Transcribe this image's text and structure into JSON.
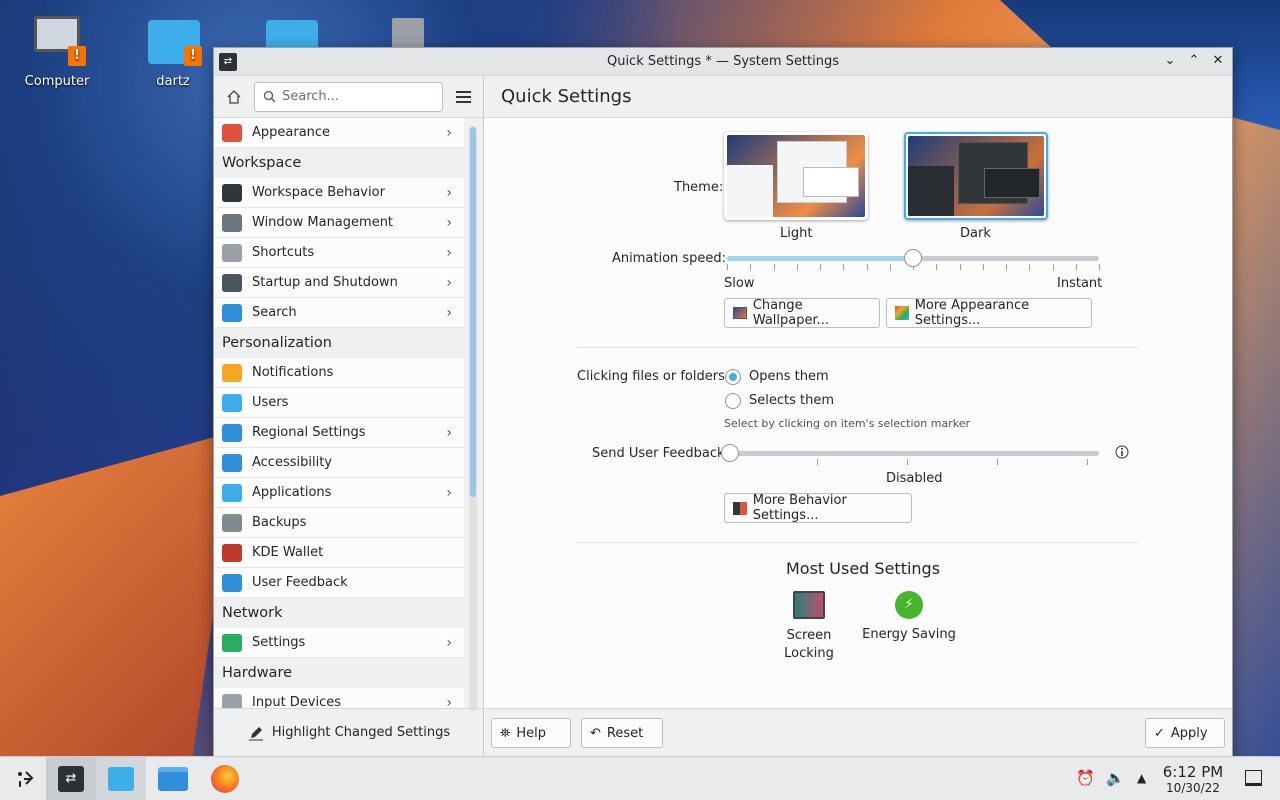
{
  "desktop": {
    "icons": [
      {
        "label": "Computer"
      },
      {
        "label": "dartz"
      }
    ]
  },
  "window": {
    "title": "Quick Settings * — System Settings",
    "controls": {
      "minimize": "⌄",
      "maximize": "⌃",
      "close": "✕"
    }
  },
  "sidebar": {
    "search_placeholder": "Search...",
    "items": [
      {
        "type": "item",
        "label": "Appearance",
        "chevron": true,
        "color": "#e0533a"
      },
      {
        "type": "category",
        "label": "Workspace"
      },
      {
        "type": "item",
        "label": "Workspace Behavior",
        "chevron": true,
        "color": "#31363b"
      },
      {
        "type": "item",
        "label": "Window Management",
        "chevron": true,
        "color": "#6c7680"
      },
      {
        "type": "item",
        "label": "Shortcuts",
        "chevron": true,
        "color": "#9aa0a6"
      },
      {
        "type": "item",
        "label": "Startup and Shutdown",
        "chevron": true,
        "color": "#4a5560"
      },
      {
        "type": "item",
        "label": "Search",
        "chevron": true,
        "color": "#2f8fd8"
      },
      {
        "type": "category",
        "label": "Personalization"
      },
      {
        "type": "item",
        "label": "Notifications",
        "chevron": false,
        "color": "#f5a623"
      },
      {
        "type": "item",
        "label": "Users",
        "chevron": false,
        "color": "#3daee9"
      },
      {
        "type": "item",
        "label": "Regional Settings",
        "chevron": true,
        "color": "#2f8fd8"
      },
      {
        "type": "item",
        "label": "Accessibility",
        "chevron": false,
        "color": "#2f8fd8"
      },
      {
        "type": "item",
        "label": "Applications",
        "chevron": true,
        "color": "#3daee9"
      },
      {
        "type": "item",
        "label": "Backups",
        "chevron": false,
        "color": "#7f8c8d"
      },
      {
        "type": "item",
        "label": "KDE Wallet",
        "chevron": false,
        "color": "#c0392b"
      },
      {
        "type": "item",
        "label": "User Feedback",
        "chevron": false,
        "color": "#2f8fd8"
      },
      {
        "type": "category",
        "label": "Network"
      },
      {
        "type": "item",
        "label": "Settings",
        "chevron": true,
        "color": "#27ae60"
      },
      {
        "type": "category",
        "label": "Hardware"
      },
      {
        "type": "item",
        "label": "Input Devices",
        "chevron": true,
        "color": "#9aa0a6"
      }
    ],
    "highlight_label": "Highlight Changed Settings"
  },
  "main": {
    "title": "Quick Settings",
    "theme_label": "Theme:",
    "theme_light": "Light",
    "theme_dark": "Dark",
    "animation_label": "Animation speed:",
    "animation_value": 0.5,
    "slow_label": "Slow",
    "instant_label": "Instant",
    "change_wallpaper": "Change Wallpaper...",
    "more_appearance": "More Appearance Settings...",
    "clicking_label": "Clicking files or folders:",
    "opens_them": "Opens them",
    "selects_them": "Selects them",
    "selects_hint": "Select by clicking on item's selection marker",
    "feedback_label": "Send User Feedback:",
    "feedback_value": "Disabled",
    "more_behavior": "More Behavior Settings...",
    "most_used_title": "Most Used Settings",
    "screen_locking": "Screen\nLocking",
    "energy_saving": "Energy Saving",
    "help": "Help",
    "reset": "Reset",
    "apply": "Apply"
  },
  "taskbar": {
    "time": "6:12 PM",
    "date": "10/30/22"
  },
  "colors": {
    "accent": "#3daee9"
  }
}
